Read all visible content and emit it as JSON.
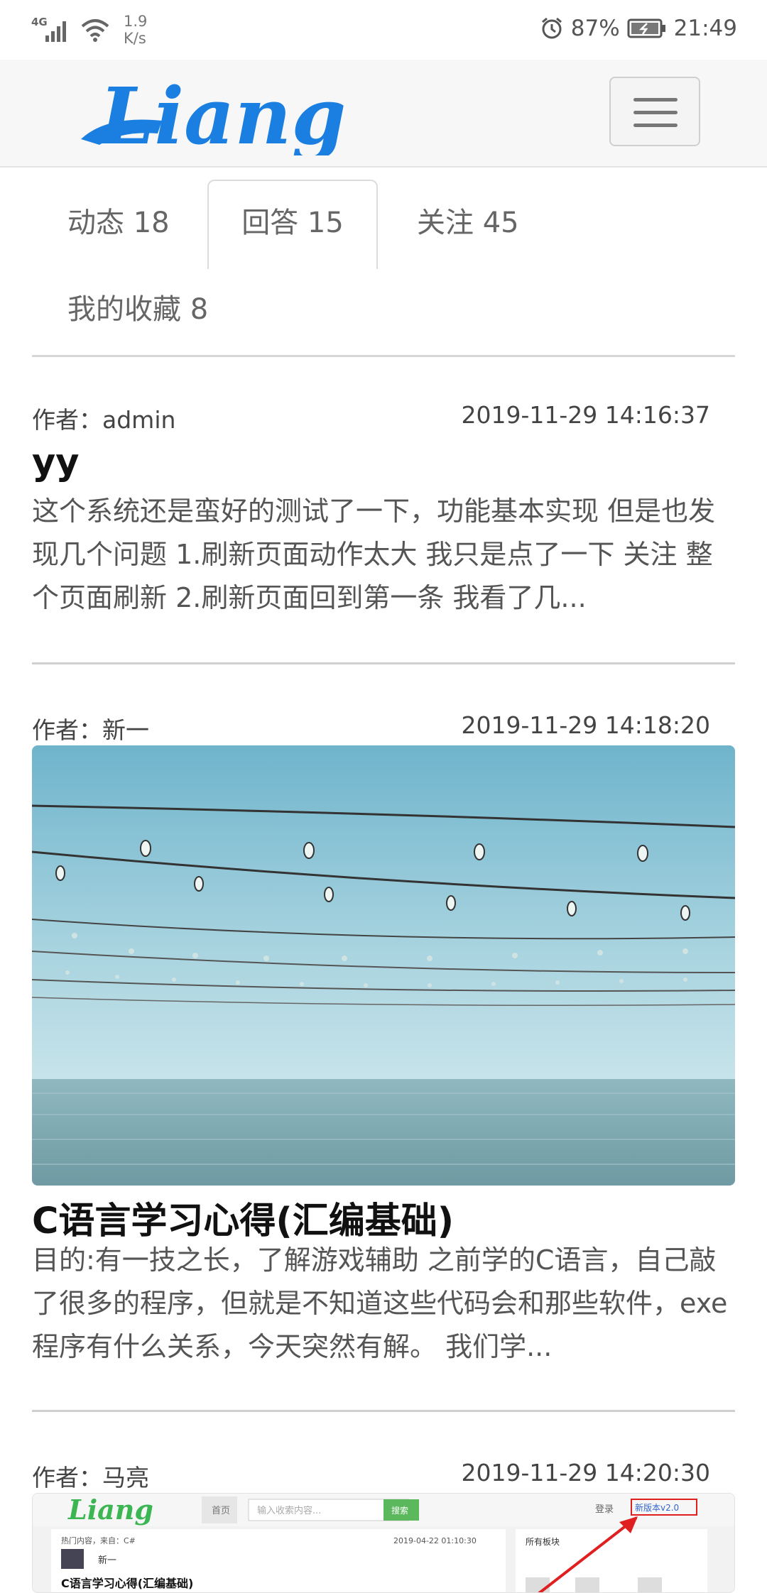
{
  "status_bar": {
    "network": "4G",
    "speed_value": "1.9",
    "speed_unit": "K/s",
    "battery": "87%",
    "time": "21:49"
  },
  "navbar": {
    "logo_text": "Liang",
    "brand_color": "#1a7fe0"
  },
  "tabs": [
    {
      "label": "动态 18",
      "active": false
    },
    {
      "label": "回答 15",
      "active": true
    },
    {
      "label": "关注 45",
      "active": false
    },
    {
      "label": "我的收藏 8",
      "active": false
    }
  ],
  "posts": [
    {
      "author": "作者：admin",
      "time": "2019-11-29 14:16:37",
      "title": "yy",
      "excerpt": "这个系统还是蛮好的测试了一下，功能基本实现 但是也发现几个问题 1.刷新页面动作太大 我只是点了一下 关注 整个页面刷新 2.刷新页面回到第一条 我看了几..."
    },
    {
      "author": "作者：新一",
      "time": "2019-11-29 14:18:20",
      "title": "C语言学习心得(汇编基础)",
      "excerpt": "目的:有一技之长，了解游戏辅助 之前学的C语言，自己敲了很多的程序，但就是不知道这些代码会和那些软件，exe程序有什么关系，今天突然有解。 我们学..."
    },
    {
      "author": "作者：马亮",
      "time": "2019-11-29 14:20:30",
      "thumb": {
        "logo_text": "Liang",
        "nav_home": "首页",
        "search_placeholder": "输入收索内容...",
        "search_button": "搜索",
        "login": "登录",
        "new_version": "新版本v2.0",
        "hot_label": "热门内容，来自：C#",
        "hot_time": "2019-04-22 01:10:30",
        "user": "新一",
        "article_title": "C语言学习心得(汇编基础)",
        "side_title": "所有板块"
      }
    }
  ]
}
